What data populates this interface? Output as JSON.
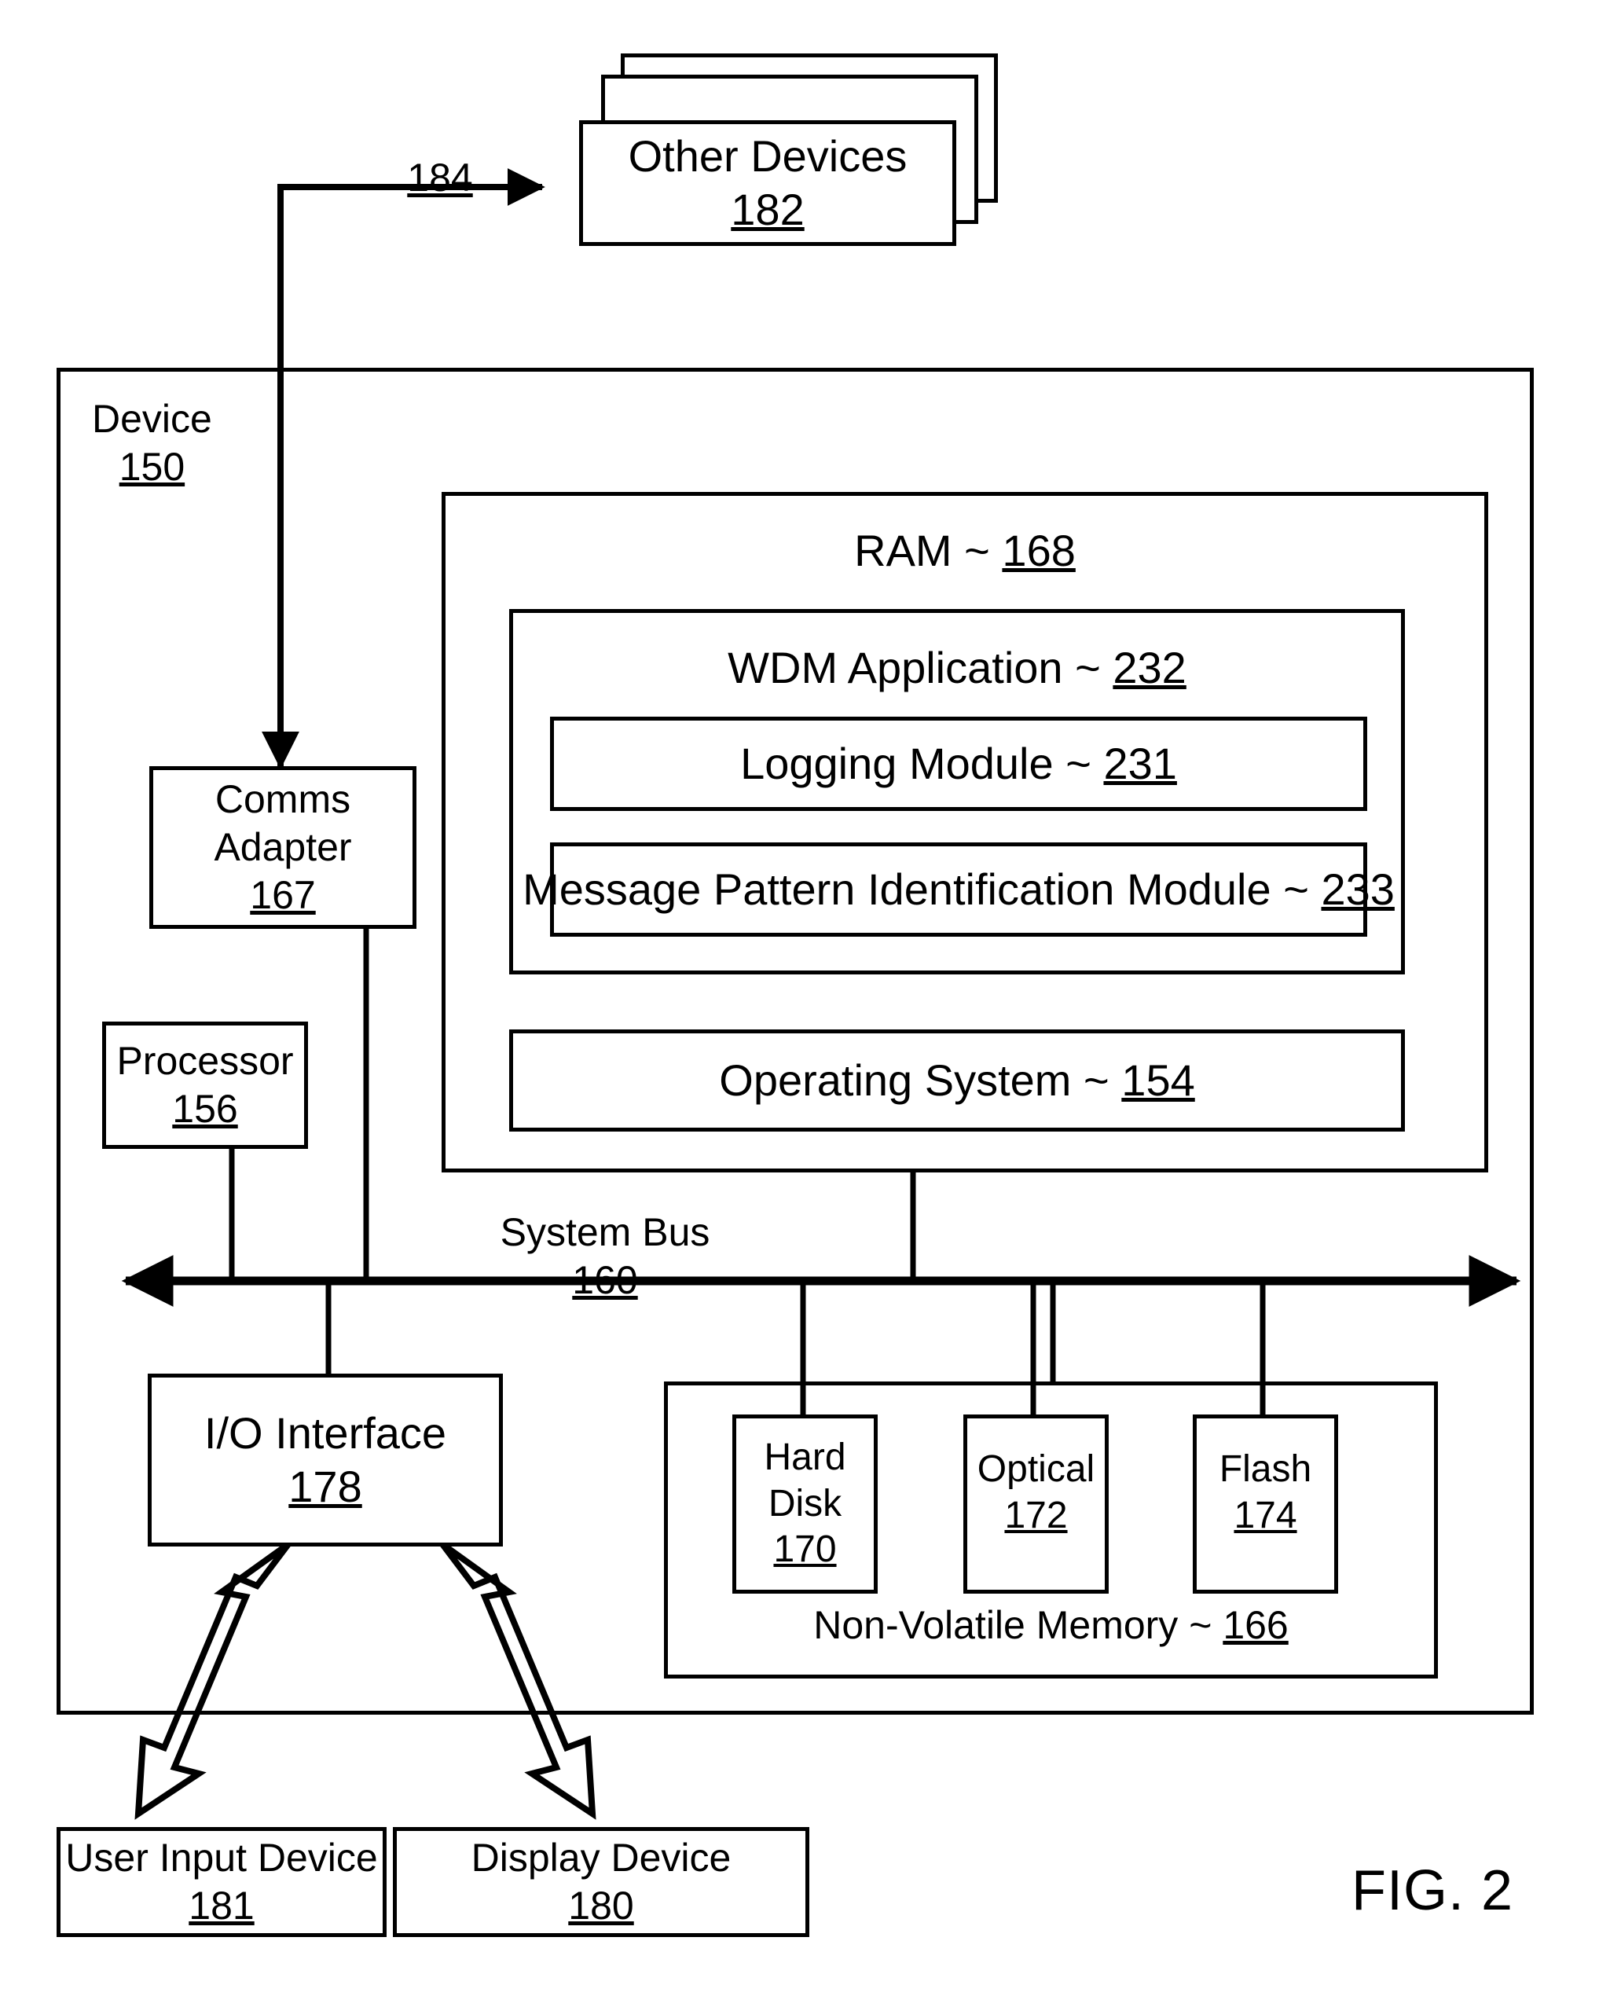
{
  "figure": {
    "label": "FIG. 2"
  },
  "nodes": {
    "other_devices": {
      "name": "Other Devices",
      "ref": "182"
    },
    "device": {
      "name": "Device",
      "ref": "150"
    },
    "ram": {
      "name": "RAM",
      "sep": "~",
      "ref": "168"
    },
    "wdm_application": {
      "name": "WDM Application",
      "sep": "~",
      "ref": "232"
    },
    "logging_module": {
      "name": "Logging Module",
      "sep": "~",
      "ref": "231"
    },
    "message_pattern_module": {
      "name": "Message Pattern Identification Module",
      "sep": "~",
      "ref": "233"
    },
    "operating_system": {
      "name": "Operating System",
      "sep": "~",
      "ref": "154"
    },
    "comms_adapter": {
      "name_line1": "Comms",
      "name_line2": "Adapter",
      "ref": "167"
    },
    "processor": {
      "name": "Processor",
      "ref": "156"
    },
    "io_interface": {
      "name": "I/O Interface",
      "ref": "178"
    },
    "hard_disk": {
      "name_line1": "Hard",
      "name_line2": "Disk",
      "ref": "170"
    },
    "optical": {
      "name": "Optical",
      "ref": "172"
    },
    "flash": {
      "name": "Flash",
      "ref": "174"
    },
    "non_volatile_memory": {
      "name": "Non-Volatile Memory",
      "sep": "~",
      "ref": "166"
    },
    "user_input_device": {
      "name": "User Input Device",
      "ref": "181"
    },
    "display_device": {
      "name": "Display Device",
      "ref": "180"
    }
  },
  "connectors": {
    "comms_to_other_devices": {
      "ref": "184"
    },
    "system_bus": {
      "name": "System Bus",
      "ref": "160"
    }
  },
  "style": {
    "ink": "#000000",
    "paper": "#ffffff"
  }
}
